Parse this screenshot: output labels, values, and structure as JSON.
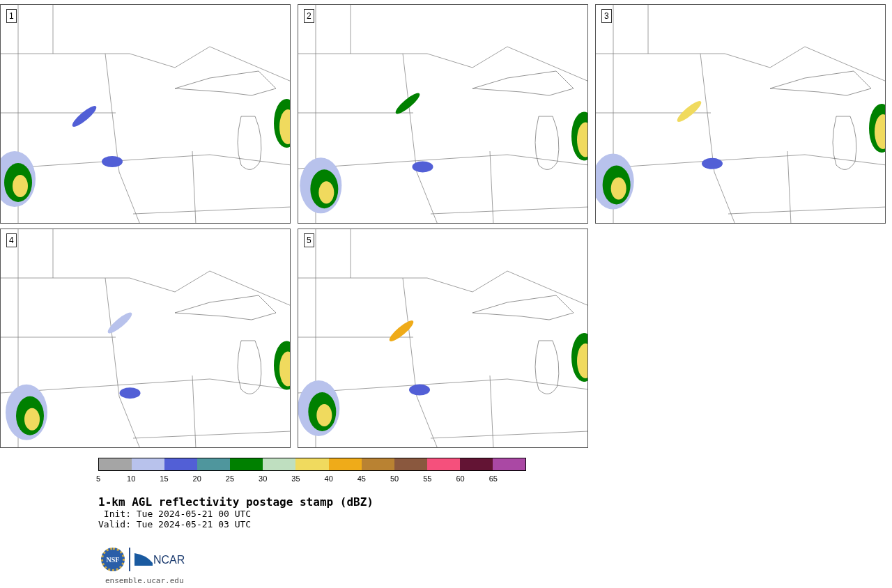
{
  "panels": [
    {
      "label": "1"
    },
    {
      "label": "2"
    },
    {
      "label": "3"
    },
    {
      "label": "4"
    },
    {
      "label": "5"
    }
  ],
  "colorbar": {
    "segments": [
      {
        "color": "#a5a5a5"
      },
      {
        "color": "#b8c2ec"
      },
      {
        "color": "#525fd6"
      },
      {
        "color": "#4f969d"
      },
      {
        "color": "#008000"
      },
      {
        "color": "#bfdfc0"
      },
      {
        "color": "#f0da5e"
      },
      {
        "color": "#efab19"
      },
      {
        "color": "#b98232"
      },
      {
        "color": "#8a583e"
      },
      {
        "color": "#f5507c"
      },
      {
        "color": "#631434"
      },
      {
        "color": "#aa48a4"
      }
    ],
    "ticks": [
      "5",
      "10",
      "15",
      "20",
      "25",
      "30",
      "35",
      "40",
      "45",
      "50",
      "55",
      "60",
      "65"
    ]
  },
  "title": "1-km AGL reflectivity postage stamp (dBZ)",
  "init": " Init: Tue 2024-05-21 00 UTC",
  "valid": "Valid: Tue 2024-05-21 03 UTC",
  "logo": {
    "nsf": "NSF",
    "ncar": "NCAR"
  },
  "url": "ensemble.ucar.edu"
}
